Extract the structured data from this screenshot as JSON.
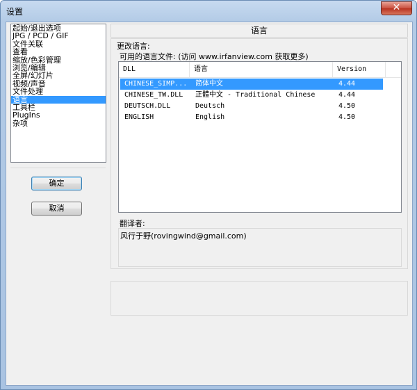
{
  "window": {
    "title": "设置",
    "close_glyph": "✕"
  },
  "categories": {
    "items": [
      "起始/退出选项",
      "JPG / PCD / GIF",
      "文件关联",
      "查看",
      "缩放/色彩管理",
      "浏览/编辑",
      "全屏/幻灯片",
      "视频/声音",
      "文件处理",
      "语言",
      "工具栏",
      "PlugIns",
      "杂项"
    ],
    "selected_index": 9
  },
  "buttons": {
    "ok": "确定",
    "cancel": "取消"
  },
  "panel": {
    "header": "语言",
    "change_language_label": "更改语言:",
    "available_files_label": "可用的语言文件: (访问 www.irfanview.com 获取更多)",
    "translator_label": "翻译者:",
    "translator_value": "风行于野(rovingwind@gmail.com)"
  },
  "language_table": {
    "columns": [
      "DLL",
      "语言",
      "Version"
    ],
    "rows": [
      [
        "CHINESE_SIMP...",
        "简体中文",
        "4.44"
      ],
      [
        "CHINESE_TW.DLL",
        "正體中文 - Traditional Chinese",
        "4.44"
      ],
      [
        "DEUTSCH.DLL",
        "Deutsch",
        "4.50"
      ],
      [
        "ENGLISH",
        "English",
        "4.50"
      ]
    ],
    "selected_row": 0
  },
  "colors": {
    "selection": "#3399ff",
    "title_gradient": "#b3cbe6",
    "close_button": "#c9503f"
  }
}
